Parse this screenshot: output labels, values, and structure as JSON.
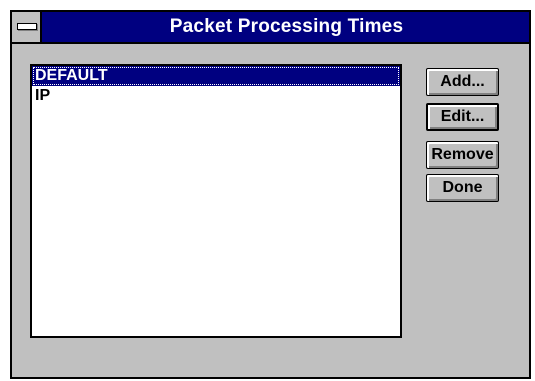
{
  "window": {
    "title": "Packet Processing Times"
  },
  "list": {
    "items": [
      {
        "label": "DEFAULT",
        "selected": true
      },
      {
        "label": "IP",
        "selected": false
      }
    ]
  },
  "buttons": {
    "add": "Add...",
    "edit": "Edit...",
    "remove": "Remove",
    "done": "Done"
  },
  "icons": {
    "system_menu": "system-menu-icon"
  },
  "colors": {
    "titlebar": "#000080",
    "face": "#c0c0c0",
    "selection": "#000080"
  }
}
